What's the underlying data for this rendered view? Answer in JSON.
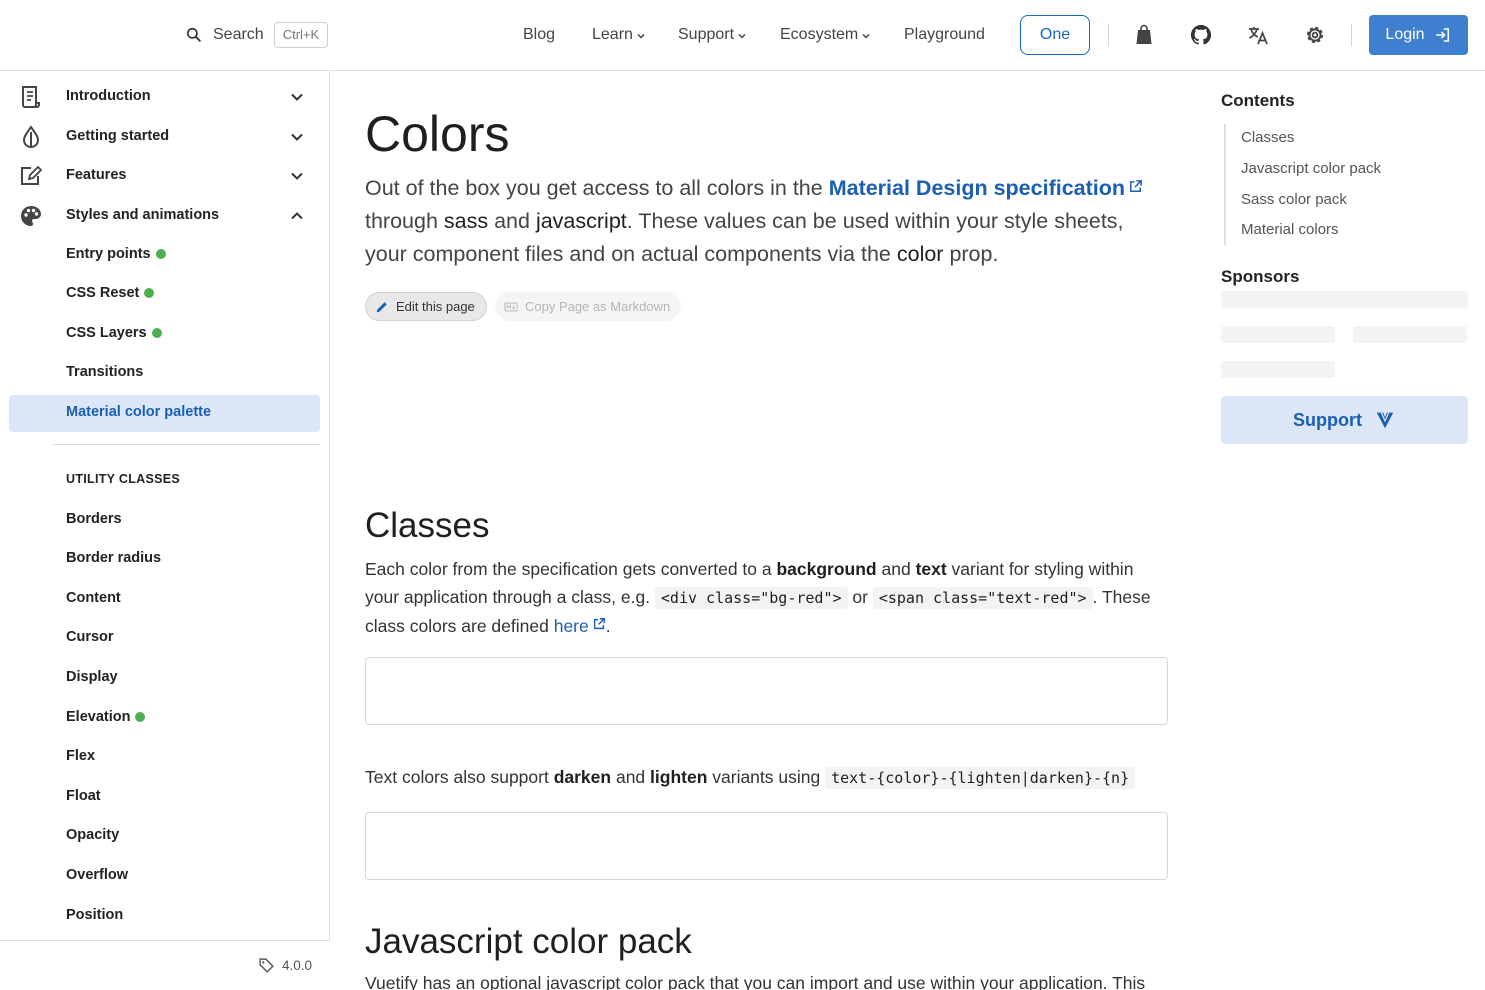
{
  "header": {
    "search_label": "Search",
    "search_shortcut": "Ctrl+K",
    "nav": [
      {
        "label": "Blog"
      },
      {
        "label": "Learn"
      },
      {
        "label": "Support"
      },
      {
        "label": "Ecosystem"
      },
      {
        "label": "Playground"
      }
    ],
    "one_label": "One",
    "login_label": "Login"
  },
  "sidebar": {
    "sections": [
      {
        "label": "Introduction"
      },
      {
        "label": "Getting started"
      },
      {
        "label": "Features"
      },
      {
        "label": "Styles and animations"
      }
    ],
    "sub_items": [
      {
        "label": "Entry points",
        "new": true
      },
      {
        "label": "CSS Reset",
        "new": true
      },
      {
        "label": "CSS Layers",
        "new": true
      },
      {
        "label": "Transitions",
        "new": false
      }
    ],
    "active_item": "Material color palette",
    "utility_heading": "UTILITY CLASSES",
    "utility_items": [
      {
        "label": "Borders"
      },
      {
        "label": "Border radius"
      },
      {
        "label": "Content"
      },
      {
        "label": "Cursor"
      },
      {
        "label": "Display"
      },
      {
        "label": "Elevation",
        "new": true
      },
      {
        "label": "Flex"
      },
      {
        "label": "Float"
      },
      {
        "label": "Opacity"
      },
      {
        "label": "Overflow"
      },
      {
        "label": "Position"
      }
    ],
    "version": "4.0.0"
  },
  "main": {
    "title": "Colors",
    "lead": {
      "t1": "Out of the box you get access to all colors in the ",
      "link": "Material Design specification",
      "t2": " through ",
      "b1": "sass",
      "t3": " and ",
      "b2": "javascript",
      "t4": ". These values can be used within your style sheets, your component files and on actual components via the ",
      "b3": "color",
      "t5": " prop."
    },
    "edit_chip": "Edit this page",
    "copy_chip": "Copy Page as Markdown",
    "classes": {
      "heading": "Classes",
      "p1": "Each color from the specification gets converted to a ",
      "b1": "background",
      "p2": " and ",
      "b2": "text",
      "p3": " variant for styling within your application through a class, e.g. ",
      "code1": "<div class=\"bg-red\">",
      "p4": " or ",
      "code2": "<span class=\"text-red\">",
      "p5": ". These class colors are defined ",
      "link": "here",
      "p6": "."
    },
    "variants": {
      "p1": "Text colors also support ",
      "b1": "darken",
      "p2": " and ",
      "b2": "lighten",
      "p3": " variants using ",
      "code": "text-{color}-{lighten|darken}-{n}"
    },
    "js_pack": {
      "heading": "Javascript color pack",
      "p1": "Vuetify has an optional javascript color pack that you can import and use within your application. This"
    }
  },
  "toc": {
    "title": "Contents",
    "items": [
      {
        "label": "Classes"
      },
      {
        "label": "Javascript color pack"
      },
      {
        "label": "Sass color pack"
      },
      {
        "label": "Material colors"
      }
    ],
    "sponsors_title": "Sponsors",
    "support_label": "Support"
  },
  "colors": {
    "primary": "#1867c0",
    "link": "#1a5fb4",
    "active_bg": "#dbe6f7",
    "new_dot": "#4caf50"
  },
  "icons": [
    "search-icon",
    "chevron-down-icon",
    "bag-icon",
    "github-icon",
    "translate-icon",
    "gear-icon",
    "login-icon",
    "tag-icon",
    "pencil-icon",
    "markdown-icon",
    "external-link-icon",
    "vuetify-icon"
  ]
}
